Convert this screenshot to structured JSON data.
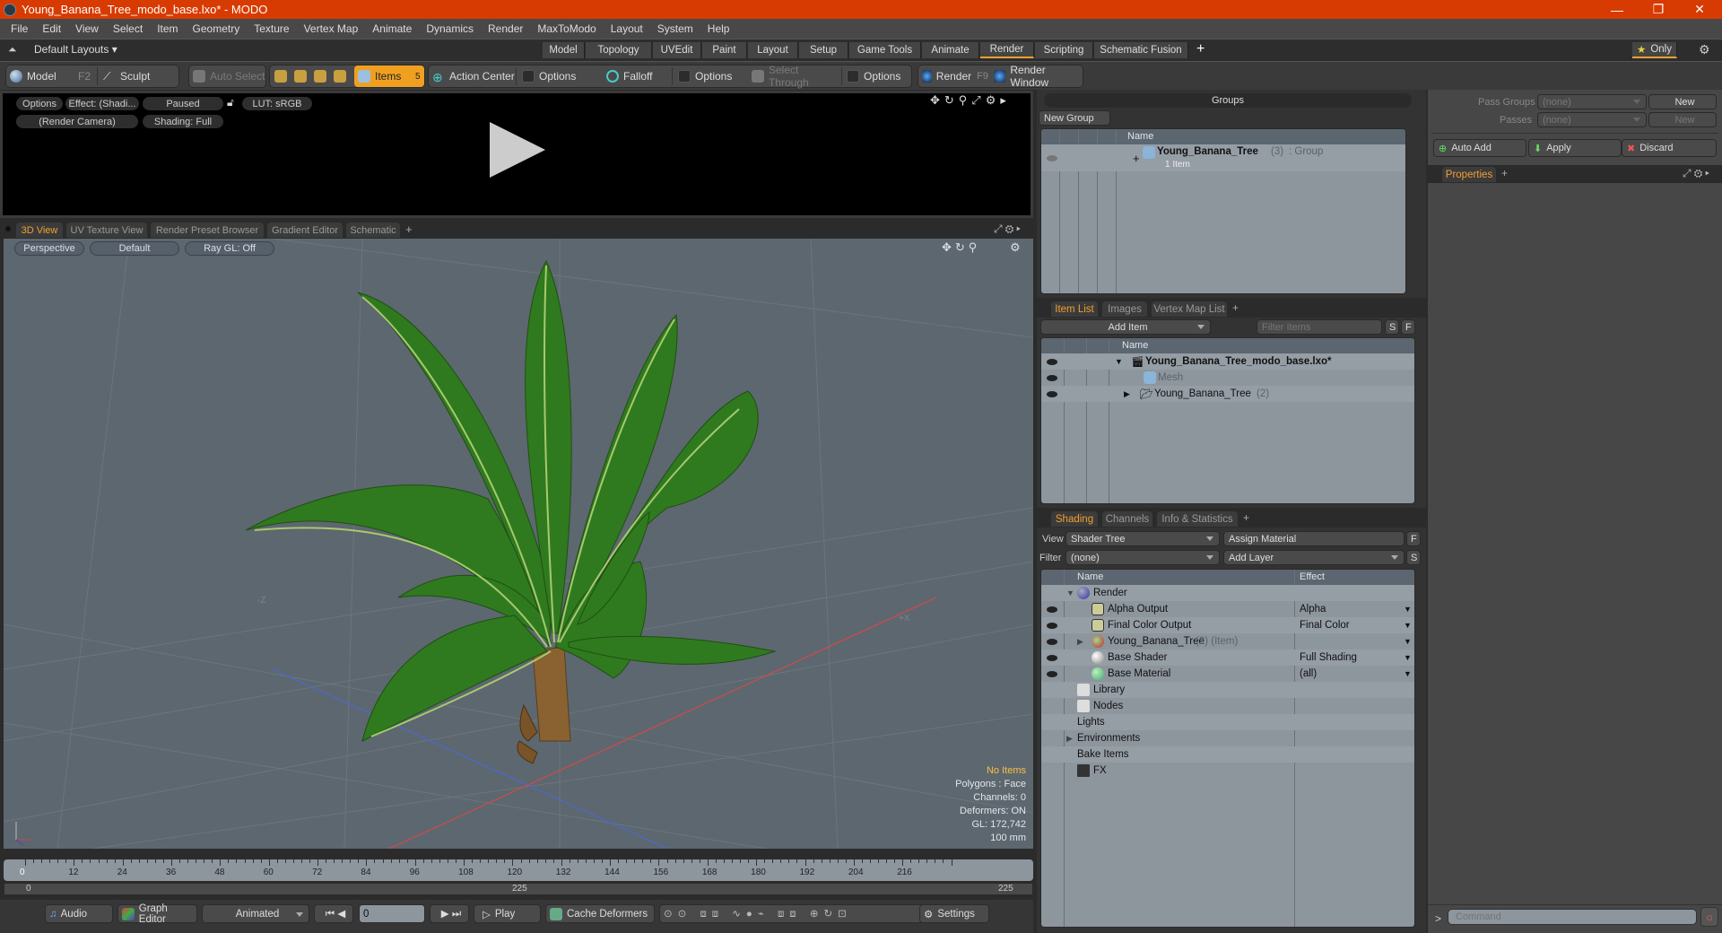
{
  "window": {
    "title": "Young_Banana_Tree_modo_base.lxo* - MODO",
    "minimize": "—",
    "restore": "❐",
    "close": "✕",
    "accent_color": "#d83b01"
  },
  "menu": [
    "File",
    "Edit",
    "View",
    "Select",
    "Item",
    "Geometry",
    "Texture",
    "Vertex Map",
    "Animate",
    "Dynamics",
    "Render",
    "MaxToModo",
    "Layout",
    "System",
    "Help"
  ],
  "layout_bar": {
    "layouts_label": "Default Layouts ▾",
    "tabs": [
      "Model",
      "Topology",
      "UVEdit",
      "Paint",
      "Layout",
      "Setup",
      "Game Tools",
      "Animate",
      "Render",
      "Scripting",
      "Schematic Fusion"
    ],
    "active_tab": "Render",
    "add": "+",
    "only_label": "Only"
  },
  "toolbar": {
    "model": "Model",
    "model_key": "F2",
    "sculpt": "Sculpt",
    "auto_select": "Auto Select",
    "items": "Items",
    "items_count": "5",
    "action_center": "Action Center",
    "options1": "Options",
    "falloff": "Falloff",
    "options2": "Options",
    "select_through": "Select Through",
    "options3": "Options",
    "render": "Render",
    "render_key": "F9",
    "render_window": "Render Window"
  },
  "render_preview": {
    "options": "Options",
    "effect": "Effect: (Shadi...",
    "paused": "Paused",
    "lut": "LUT: sRGB",
    "camera": "(Render Camera)",
    "shading": "Shading: Full"
  },
  "view_tabs": {
    "tabs": [
      "3D View",
      "UV Texture View",
      "Render Preset Browser",
      "Gradient Editor",
      "Schematic"
    ],
    "active": "3D View",
    "add": "+"
  },
  "viewport": {
    "perspective": "Perspective",
    "default": "Default",
    "raygl": "Ray GL: Off",
    "axis_neg_z": "-Z",
    "axis_pos_x": "+X",
    "stats": {
      "selection": "No Items",
      "polygons": "Polygons : Face",
      "channels": "Channels: 0",
      "deformers": "Deformers: ON",
      "gl": "GL: 172,742",
      "scale": "100 mm"
    }
  },
  "timeline": {
    "ticks": [
      "0",
      "12",
      "24",
      "36",
      "48",
      "60",
      "72",
      "84",
      "96",
      "108",
      "120",
      "132",
      "144",
      "156",
      "168",
      "180",
      "192",
      "204",
      "216"
    ],
    "range_start": "0",
    "range_mid": "225",
    "range_end": "225",
    "current_frame": "0"
  },
  "bottom_bar": {
    "audio": "Audio",
    "graph_editor": "Graph Editor",
    "animated": "Animated",
    "frame": "0",
    "play": "Play",
    "cache_deformers": "Cache Deformers",
    "settings": "Settings"
  },
  "groups": {
    "title": "Groups",
    "new_group": "New Group",
    "col_name": "Name",
    "rows": [
      {
        "name": "Young_Banana_Tree",
        "count": "(3)",
        "type": ": Group",
        "sub": "1 Item"
      }
    ]
  },
  "passes": {
    "pass_groups_label": "Pass Groups",
    "pass_groups_value": "(none)",
    "passes_label": "Passes",
    "passes_value": "(none)",
    "new1": "New",
    "new2": "New",
    "auto_add": "Auto Add",
    "apply": "Apply",
    "discard": "Discard"
  },
  "properties": {
    "tab": "Properties",
    "add": "+"
  },
  "item_list": {
    "tabs": [
      "Item List",
      "Images",
      "Vertex Map List"
    ],
    "active": "Item List",
    "add": "+",
    "add_item": "Add Item",
    "filter_placeholder": "Filter Items",
    "s_btn": "S",
    "f_btn": "F",
    "col_name": "Name",
    "rows": [
      {
        "name": "Young_Banana_Tree_modo_base.lxo*",
        "extra": ""
      },
      {
        "name": "Mesh",
        "extra": ""
      },
      {
        "name": "Young_Banana_Tree",
        "extra": "(2)"
      }
    ]
  },
  "shading": {
    "tabs": [
      "Shading",
      "Channels",
      "Info & Statistics"
    ],
    "active": "Shading",
    "add": "+",
    "view_label": "View",
    "view_value": "Shader Tree",
    "assign_material": "Assign Material",
    "f_btn": "F",
    "filter_label": "Filter",
    "filter_value": "(none)",
    "add_layer": "Add Layer",
    "s_btn": "S",
    "col_name": "Name",
    "col_effect": "Effect",
    "rows": [
      {
        "name": "Render",
        "extra": "",
        "effect": ""
      },
      {
        "name": "Alpha Output",
        "extra": "",
        "effect": "Alpha"
      },
      {
        "name": "Final Color Output",
        "extra": "",
        "effect": "Final Color"
      },
      {
        "name": "Young_Banana_Tree",
        "extra": "(2) (Item)",
        "effect": ""
      },
      {
        "name": "Base Shader",
        "extra": "",
        "effect": "Full Shading"
      },
      {
        "name": "Base Material",
        "extra": "",
        "effect": "(all)"
      },
      {
        "name": "Library",
        "extra": "",
        "effect": ""
      },
      {
        "name": "Nodes",
        "extra": "",
        "effect": ""
      },
      {
        "name": "Lights",
        "extra": "",
        "effect": ""
      },
      {
        "name": "Environments",
        "extra": "",
        "effect": ""
      },
      {
        "name": "Bake Items",
        "extra": "",
        "effect": ""
      },
      {
        "name": "FX",
        "extra": "",
        "effect": ""
      }
    ]
  },
  "command": {
    "prompt": ">",
    "placeholder": "Command"
  }
}
